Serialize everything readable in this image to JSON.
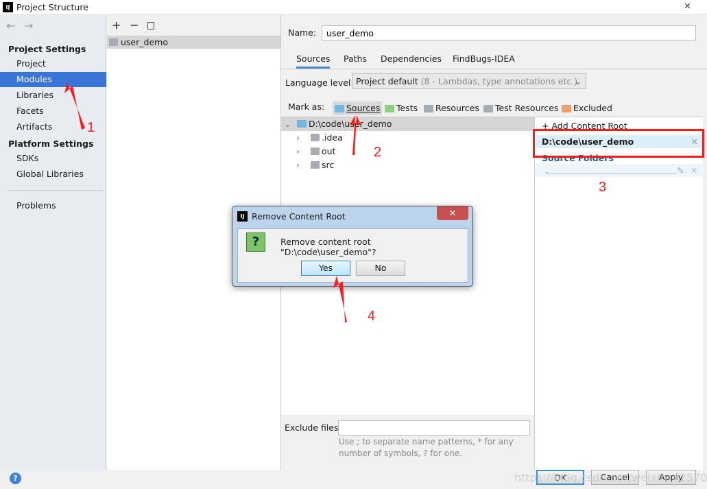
{
  "window": {
    "title": "Project Structure",
    "icon": "intellij-icon",
    "close": "close-icon"
  },
  "sidebar": {
    "nav": {
      "back": "←",
      "forward": "→"
    },
    "project_settings": "Project Settings",
    "project_items": [
      {
        "label": "Project"
      },
      {
        "label": "Modules",
        "selected": true
      },
      {
        "label": "Libraries"
      },
      {
        "label": "Facets"
      },
      {
        "label": "Artifacts"
      }
    ],
    "platform_settings": "Platform Settings",
    "platform_items": [
      {
        "label": "SDKs"
      },
      {
        "label": "Global Libraries"
      }
    ],
    "problems": "Problems"
  },
  "modules": {
    "toolbar": {
      "add": "+",
      "remove": "−",
      "copy": "copy-icon"
    },
    "items": [
      "user_demo"
    ]
  },
  "module": {
    "name_label": "Name:",
    "name_value": "user_demo",
    "tabs": [
      "Sources",
      "Paths",
      "Dependencies",
      "FindBugs-IDEA"
    ],
    "active_tab": "Sources",
    "language_label": "Language level:",
    "language_value": "Project default",
    "language_hint": "(8 - Lambdas, type annotations etc.)",
    "mark_as": "Mark as:",
    "marks": [
      {
        "label": "Sources",
        "color": "#6fb8e0"
      },
      {
        "label": "Tests",
        "color": "#8ccf7e"
      },
      {
        "label": "Resources",
        "color": "#a8adb3"
      },
      {
        "label": "Test Resources",
        "color": "#a8adb3"
      },
      {
        "label": "Excluded",
        "color": "#f0a070"
      }
    ],
    "tree": {
      "root": "D:\\code\\user_demo",
      "children": [
        ".idea",
        "out",
        "src"
      ]
    },
    "add_content_root": "Add Content Root",
    "content_root": "D:\\code\\user_demo",
    "source_folders": "Source Folders",
    "source_folder_value": ".",
    "exclude_label": "Exclude files:",
    "exclude_value": "",
    "exclude_hint_1": "Use ; to separate name patterns, * for any",
    "exclude_hint_2": "number of symbols, ? for one."
  },
  "footer": {
    "help": "?",
    "ok": "OK",
    "cancel": "Cancel",
    "apply": "Apply",
    "watermark": "https://blog.csdn.net/weixin_42570367"
  },
  "dialog": {
    "title": "Remove Content Root",
    "message": "Remove content root \"D:\\code\\user_demo\"?",
    "icon": "question-icon",
    "yes": "Yes",
    "no": "No"
  },
  "annotations": {
    "n1": "1",
    "n2": "2",
    "n3": "3",
    "n4": "4",
    "color": "#ff1a1a"
  }
}
